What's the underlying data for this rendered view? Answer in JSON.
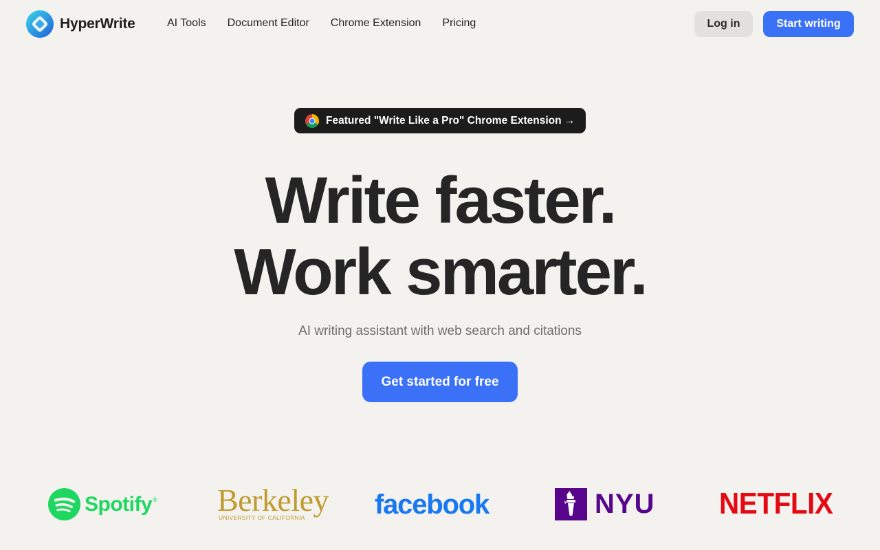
{
  "header": {
    "brand_name": "HyperWrite",
    "brand_icon": "hyperwrite-logo-icon",
    "nav": [
      {
        "label": "AI Tools"
      },
      {
        "label": "Document Editor"
      },
      {
        "label": "Chrome Extension"
      },
      {
        "label": "Pricing"
      }
    ],
    "login_label": "Log in",
    "start_label": "Start writing"
  },
  "featured": {
    "icon": "chrome-icon",
    "text": "Featured \"Write Like a Pro\" Chrome Extension →"
  },
  "hero": {
    "line1": "Write faster.",
    "line2": "Work smarter.",
    "subtitle": "AI writing assistant with web search and citations",
    "cta_label": "Get started for free"
  },
  "logos": {
    "spotify": {
      "name": "Spotify",
      "reg": "®"
    },
    "berkeley": {
      "name": "Berkeley",
      "sub": "UNIVERSITY OF CALIFORNIA"
    },
    "facebook": {
      "name": "facebook"
    },
    "nyu": {
      "name": "NYU"
    },
    "netflix": {
      "name": "NETFLIX"
    }
  },
  "colors": {
    "background": "#f3f2ef",
    "accent": "#3b71f7",
    "text": "#252525",
    "pill_bg": "#1c1c1c"
  }
}
